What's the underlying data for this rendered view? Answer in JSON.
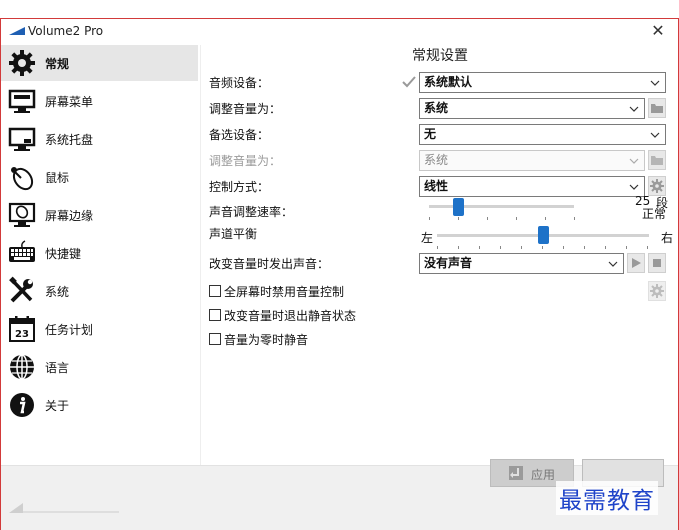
{
  "window": {
    "title": "Volume2 Pro",
    "close_glyph": "✕"
  },
  "sidebar": {
    "items": [
      {
        "label": "常规",
        "icon": "gear-icon",
        "active": true
      },
      {
        "label": "屏幕菜单",
        "icon": "monitor-icon"
      },
      {
        "label": "系统托盘",
        "icon": "tray-monitor-icon"
      },
      {
        "label": "鼠标",
        "icon": "mouse-icon"
      },
      {
        "label": "屏幕边缘",
        "icon": "screen-edge-mouse-icon"
      },
      {
        "label": "快捷键",
        "icon": "keyboard-icon"
      },
      {
        "label": "系统",
        "icon": "wrench-screwdriver-icon"
      },
      {
        "label": "任务计划",
        "icon": "calendar-icon",
        "icon_text": "23"
      },
      {
        "label": "语言",
        "icon": "globe-icon"
      },
      {
        "label": "关于",
        "icon": "info-icon"
      }
    ]
  },
  "main": {
    "title": "常规设置",
    "audio_device": {
      "label": "音频设备：",
      "value": "系统默认"
    },
    "adjust_volume": {
      "label": "调整音量为：",
      "value": "系统"
    },
    "backup_device": {
      "label": "备选设备：",
      "value": "无"
    },
    "adjust_volume_alt": {
      "label": "调整音量为：",
      "value": "系统"
    },
    "control_mode": {
      "label": "控制方式：",
      "value": "线性"
    },
    "volume_rate": {
      "label": "声音调整速率：",
      "value": "25",
      "unit": "段",
      "mode": "正常",
      "level": 0.2
    },
    "balance": {
      "label": "声道平衡",
      "left": "左",
      "right": "右",
      "level": 0.5
    },
    "change_sound": {
      "label": "改变音量时发出声音：",
      "value": "没有声音"
    },
    "checkboxes": [
      {
        "label": "全屏幕时禁用音量控制",
        "checked": false
      },
      {
        "label": "改变音量时退出静音状态",
        "checked": false
      },
      {
        "label": "音量为零时静音",
        "checked": false
      }
    ]
  },
  "bottom": {
    "apply_label": "应用"
  },
  "watermark": "最需教育",
  "colors": {
    "accent": "#1e72c8",
    "border": "#d23a3a",
    "watermark": "#1f44c9"
  }
}
